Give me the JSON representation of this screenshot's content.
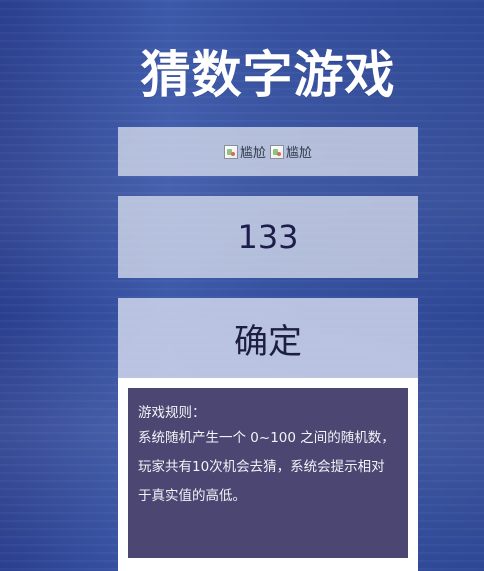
{
  "title": "猜数字游戏",
  "images": {
    "alt_1": "尴尬",
    "alt_2": "尴尬"
  },
  "guess_input": {
    "value": "133"
  },
  "confirm_button": {
    "label": "确定"
  },
  "rules": {
    "title": "游戏规则：",
    "text": "系统随机产生一个 0~100 之间的随机数，玩家共有10次机会去猜，系统会提示相对于真实值的高低。"
  },
  "colors": {
    "background": "#34509f",
    "rules_box": "#4b4772",
    "text_dark": "#1c1d4a"
  },
  "icons": {
    "broken_image": "broken-image-icon"
  }
}
